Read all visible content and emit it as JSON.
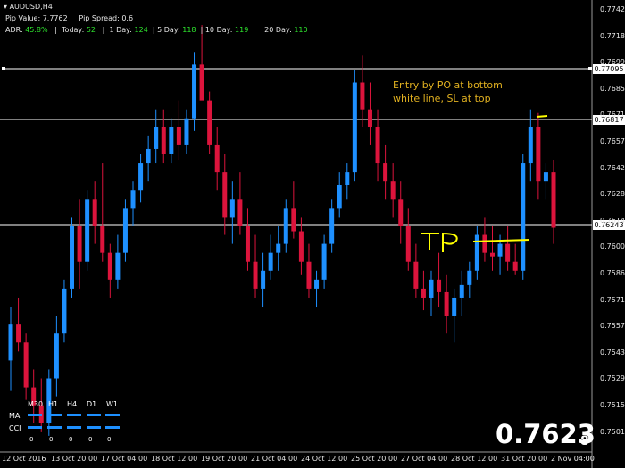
{
  "header": {
    "symbol": "AUDUSD,H4",
    "pip_value": "Pip Value: 7.7762",
    "pip_spread": "Pip Spread: 0.6",
    "adr_label": "ADR:",
    "adr_value": "45.8%",
    "today_label": "Today:",
    "today_value": "52",
    "day1_label": "1 Day:",
    "day1_value": "124",
    "day5_label": "5 Day:",
    "day5_value": "118",
    "day10_label": "10 Day:",
    "day10_value": "119",
    "day20_label": "20 Day:",
    "day20_value": "110"
  },
  "annotation": {
    "line1": "Entry by PO at bottom",
    "line2": "white line, SL at top",
    "tp_label": "TP"
  },
  "big_price": {
    "main": "0.7623",
    "sub": "8"
  },
  "price_tags": [
    "0.77095",
    "0.76817",
    "0.76243"
  ],
  "price_axis": [
    "0.77420",
    "0.77180",
    "0.76990",
    "0.76850",
    "0.76710",
    "0.76570",
    "0.76425",
    "0.76285",
    "0.76145",
    "0.76005",
    "0.75860",
    "0.75715",
    "0.75575",
    "0.75435",
    "0.75295",
    "0.75155",
    "0.75015"
  ],
  "time_axis": [
    "12 Oct 2016",
    "13 Oct 20:00",
    "17 Oct 04:00",
    "18 Oct 12:00",
    "19 Oct 20:00",
    "21 Oct 04:00",
    "24 Oct 12:00",
    "25 Oct 20:00",
    "27 Oct 04:00",
    "28 Oct 12:00",
    "31 Oct 20:00",
    "2 Nov 04:00"
  ],
  "indicator_panel": {
    "timeframes": [
      "M30",
      "H1",
      "H4",
      "D1",
      "W1"
    ],
    "rows": [
      "MA",
      "CCI"
    ],
    "values": [
      "0",
      "0",
      "0",
      "0",
      "0"
    ]
  },
  "colors": {
    "bull": "#1e90ff",
    "bear": "#dc143c",
    "annotation": "#ffff00",
    "text": "#e6e6e6",
    "value_green": "#2ee82e"
  },
  "chart_data": {
    "type": "candlestick",
    "title": "AUDUSD,H4",
    "ylim": [
      0.75,
      0.7747
    ],
    "horizontal_lines": [
      0.77095,
      0.76817,
      0.76243
    ],
    "x_labels": [
      "12 Oct 2016",
      "13 Oct 20:00",
      "17 Oct 04:00",
      "18 Oct 12:00",
      "19 Oct 20:00",
      "21 Oct 04:00",
      "24 Oct 12:00",
      "25 Oct 20:00",
      "27 Oct 04:00",
      "28 Oct 12:00",
      "31 Oct 20:00",
      "2 Nov 04:00"
    ],
    "ohlc": [
      [
        0.755,
        0.758,
        0.7533,
        0.757
      ],
      [
        0.757,
        0.7585,
        0.7555,
        0.756
      ],
      [
        0.756,
        0.7565,
        0.7528,
        0.7535
      ],
      [
        0.7535,
        0.7545,
        0.7515,
        0.7525
      ],
      [
        0.7525,
        0.754,
        0.751,
        0.7515
      ],
      [
        0.7515,
        0.7545,
        0.7508,
        0.754
      ],
      [
        0.754,
        0.7575,
        0.753,
        0.7565
      ],
      [
        0.7565,
        0.7595,
        0.756,
        0.759
      ],
      [
        0.759,
        0.763,
        0.7585,
        0.7625
      ],
      [
        0.7625,
        0.764,
        0.759,
        0.7605
      ],
      [
        0.7605,
        0.7645,
        0.76,
        0.764
      ],
      [
        0.764,
        0.765,
        0.7615,
        0.7625
      ],
      [
        0.7625,
        0.766,
        0.7605,
        0.761
      ],
      [
        0.761,
        0.7615,
        0.7585,
        0.7595
      ],
      [
        0.7595,
        0.762,
        0.759,
        0.761
      ],
      [
        0.761,
        0.764,
        0.7605,
        0.7635
      ],
      [
        0.7635,
        0.765,
        0.7625,
        0.7645
      ],
      [
        0.7645,
        0.7665,
        0.7638,
        0.766
      ],
      [
        0.766,
        0.7675,
        0.765,
        0.7668
      ],
      [
        0.7668,
        0.769,
        0.766,
        0.768
      ],
      [
        0.768,
        0.769,
        0.766,
        0.7665
      ],
      [
        0.7665,
        0.7685,
        0.766,
        0.768
      ],
      [
        0.768,
        0.7695,
        0.7662,
        0.767
      ],
      [
        0.767,
        0.769,
        0.7665,
        0.7685
      ],
      [
        0.7685,
        0.7722,
        0.7678,
        0.7715
      ],
      [
        0.7715,
        0.7737,
        0.77,
        0.7695
      ],
      [
        0.7695,
        0.77,
        0.7665,
        0.767
      ],
      [
        0.767,
        0.768,
        0.7645,
        0.7655
      ],
      [
        0.7655,
        0.7665,
        0.762,
        0.763
      ],
      [
        0.763,
        0.765,
        0.7615,
        0.764
      ],
      [
        0.764,
        0.7655,
        0.762,
        0.7625
      ],
      [
        0.7625,
        0.7635,
        0.76,
        0.7605
      ],
      [
        0.7605,
        0.762,
        0.7585,
        0.759
      ],
      [
        0.759,
        0.761,
        0.758,
        0.76
      ],
      [
        0.76,
        0.762,
        0.7595,
        0.761
      ],
      [
        0.761,
        0.7625,
        0.76,
        0.7615
      ],
      [
        0.7615,
        0.764,
        0.761,
        0.7635
      ],
      [
        0.7635,
        0.765,
        0.7618,
        0.7622
      ],
      [
        0.7622,
        0.763,
        0.7598,
        0.7605
      ],
      [
        0.7605,
        0.7615,
        0.7585,
        0.759
      ],
      [
        0.759,
        0.76,
        0.758,
        0.7595
      ],
      [
        0.7595,
        0.762,
        0.759,
        0.7615
      ],
      [
        0.7615,
        0.764,
        0.761,
        0.7635
      ],
      [
        0.7635,
        0.7655,
        0.763,
        0.7648
      ],
      [
        0.7648,
        0.766,
        0.764,
        0.7655
      ],
      [
        0.7655,
        0.7712,
        0.765,
        0.7705
      ],
      [
        0.7705,
        0.772,
        0.768,
        0.769
      ],
      [
        0.769,
        0.7705,
        0.767,
        0.768
      ],
      [
        0.768,
        0.769,
        0.765,
        0.766
      ],
      [
        0.766,
        0.767,
        0.764,
        0.765
      ],
      [
        0.765,
        0.766,
        0.763,
        0.764
      ],
      [
        0.764,
        0.765,
        0.7615,
        0.7625
      ],
      [
        0.7625,
        0.7635,
        0.76,
        0.7605
      ],
      [
        0.7605,
        0.7615,
        0.7585,
        0.759
      ],
      [
        0.759,
        0.76,
        0.7578,
        0.7585
      ],
      [
        0.7585,
        0.76,
        0.7575,
        0.7595
      ],
      [
        0.7595,
        0.761,
        0.758,
        0.7588
      ],
      [
        0.7588,
        0.7598,
        0.7565,
        0.7575
      ],
      [
        0.7575,
        0.759,
        0.756,
        0.7585
      ],
      [
        0.7585,
        0.76,
        0.7575,
        0.7592
      ],
      [
        0.7592,
        0.7605,
        0.7585,
        0.76
      ],
      [
        0.76,
        0.7625,
        0.7595,
        0.762
      ],
      [
        0.762,
        0.763,
        0.7605,
        0.761
      ],
      [
        0.761,
        0.7625,
        0.76,
        0.7608
      ],
      [
        0.7608,
        0.762,
        0.7598,
        0.7615
      ],
      [
        0.7615,
        0.7625,
        0.76,
        0.7605
      ],
      [
        0.7605,
        0.7615,
        0.7598,
        0.76
      ],
      [
        0.76,
        0.7665,
        0.7595,
        0.766
      ],
      [
        0.766,
        0.769,
        0.765,
        0.768
      ],
      [
        0.768,
        0.7688,
        0.764,
        0.765
      ],
      [
        0.765,
        0.766,
        0.764,
        0.7655
      ],
      [
        0.7655,
        0.7662,
        0.7615,
        0.7624
      ]
    ]
  }
}
